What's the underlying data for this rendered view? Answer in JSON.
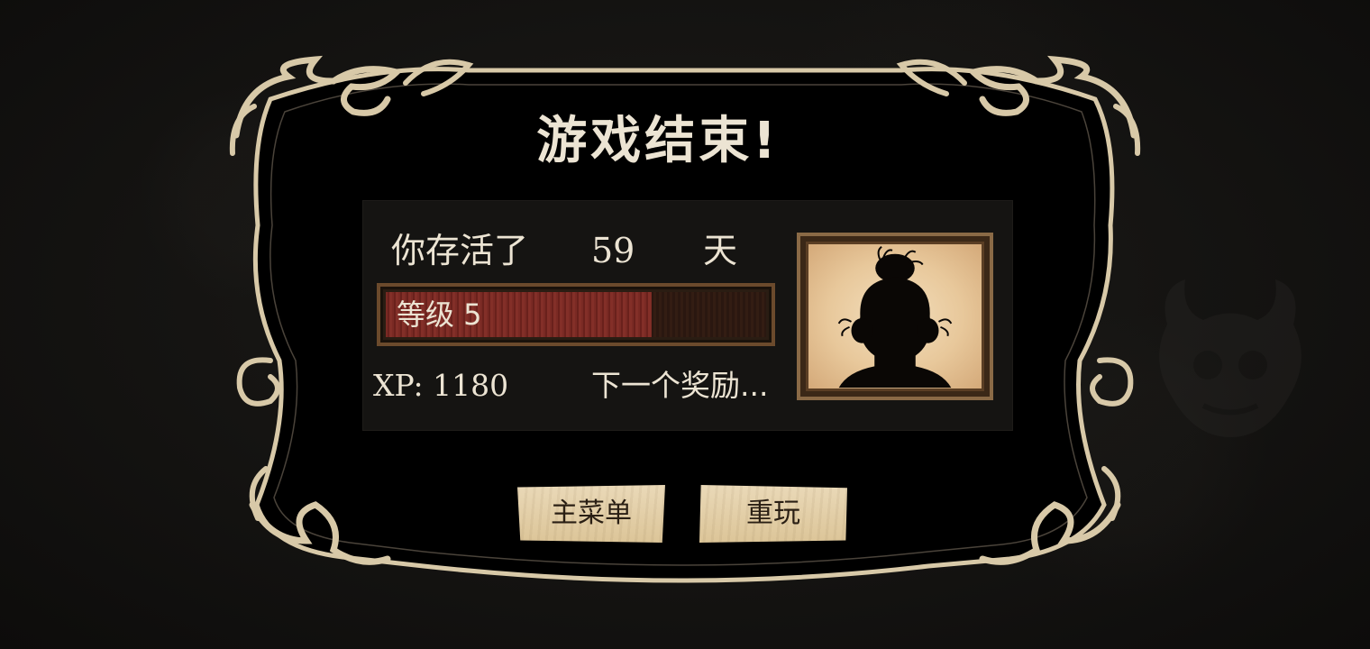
{
  "dialog": {
    "title": "游戏结束!",
    "survived_label": "你存活了",
    "days_survived": "59",
    "days_unit": "天",
    "level": {
      "label": "等级 5",
      "progress_fraction": 0.7
    },
    "xp_text": "XP: 1180",
    "next_reward_text": "下一个奖励...",
    "portrait": {
      "icon": "character-silhouette-icon"
    }
  },
  "buttons": {
    "main_menu_label": "主菜单",
    "retry_label": "重玩"
  },
  "colors": {
    "frame": "#d8c9a8",
    "panel_bg": "#000000",
    "text": "#ece4d3",
    "level_fill": "#7a2a24",
    "button_bg": "#e3d0aa"
  }
}
